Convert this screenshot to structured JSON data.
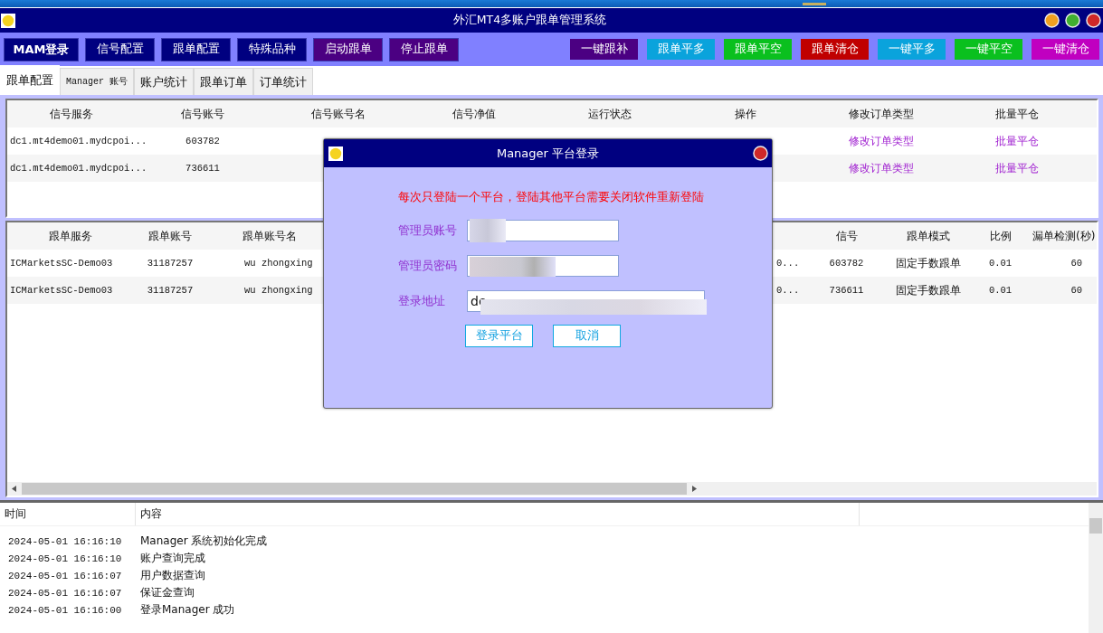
{
  "window": {
    "title": "外汇MT4多账户跟单管理系统"
  },
  "toolbar": {
    "left_buttons": [
      {
        "label": "MAM登录",
        "color": "#000080"
      },
      {
        "label": "信号配置",
        "color": "#000080"
      },
      {
        "label": "跟单配置",
        "color": "#000080"
      },
      {
        "label": "特殊品种",
        "color": "#000080"
      },
      {
        "label": "启动跟单",
        "color": "#4b0082"
      },
      {
        "label": "停止跟单",
        "color": "#4b0082"
      }
    ],
    "right_buttons": [
      {
        "label": "一键跟补",
        "color": "#4b0082"
      },
      {
        "label": "跟单平多",
        "color": "#0aa3dc"
      },
      {
        "label": "跟单平空",
        "color": "#0ac01e"
      },
      {
        "label": "跟单清仓",
        "color": "#c00000"
      },
      {
        "label": "一键平多",
        "color": "#0aa3dc"
      },
      {
        "label": "一键平空",
        "color": "#0ac01e"
      },
      {
        "label": "一键清仓",
        "color": "#c000c0"
      }
    ]
  },
  "tabs": [
    {
      "label": "跟单配置",
      "selected": true
    },
    {
      "label": "Manager 账号",
      "selected": false
    },
    {
      "label": "账户统计",
      "selected": false
    },
    {
      "label": "跟单订单",
      "selected": false
    },
    {
      "label": "订单统计",
      "selected": false
    }
  ],
  "signal_table": {
    "columns": [
      "信号服务",
      "信号账号",
      "信号账号名",
      "信号净值",
      "运行状态",
      "操作",
      "修改订单类型",
      "批量平仓"
    ],
    "rows": [
      [
        "dc1.mt4demo01.mydcpoi...",
        "603782",
        "",
        "",
        "",
        "",
        "修改订单类型",
        "批量平仓"
      ],
      [
        "dc1.mt4demo01.mydcpoi...",
        "736611",
        "",
        "",
        "",
        "",
        "修改订单类型",
        "批量平仓"
      ]
    ]
  },
  "follow_table": {
    "columns": [
      "跟单服务",
      "跟单账号",
      "跟单账号名",
      "",
      "信号",
      "跟单模式",
      "比例",
      "漏单检测(秒)"
    ],
    "rows": [
      [
        "ICMarketsSC-Demo03",
        "31187257",
        "wu zhongxing",
        "0...",
        "603782",
        "固定手数跟单",
        "0.01",
        "60"
      ],
      [
        "ICMarketsSC-Demo03",
        "31187257",
        "wu zhongxing",
        "0...",
        "736611",
        "固定手数跟单",
        "0.01",
        "60"
      ]
    ]
  },
  "log": {
    "columns": [
      "时间",
      "内容"
    ],
    "rows": [
      [
        "2024-05-01 16:16:10",
        "Manager 系统初始化完成"
      ],
      [
        "2024-05-01 16:16:10",
        "账户查询完成"
      ],
      [
        "2024-05-01 16:16:07",
        "用户数据查询"
      ],
      [
        "2024-05-01 16:16:07",
        "保证金查询"
      ],
      [
        "2024-05-01 16:16:00",
        "登录Manager 成功"
      ]
    ]
  },
  "dialog": {
    "title": "Manager 平台登录",
    "notice": "每次只登陆一个平台，登陆其他平台需要关闭软件重新登陆",
    "fields": [
      {
        "label": "管理员账号",
        "redacted": true
      },
      {
        "label": "管理员密码",
        "redacted": true
      },
      {
        "label": "登录地址",
        "value": "dc",
        "redacted": true
      }
    ],
    "buttons": [
      "登录平台",
      "取消"
    ]
  }
}
